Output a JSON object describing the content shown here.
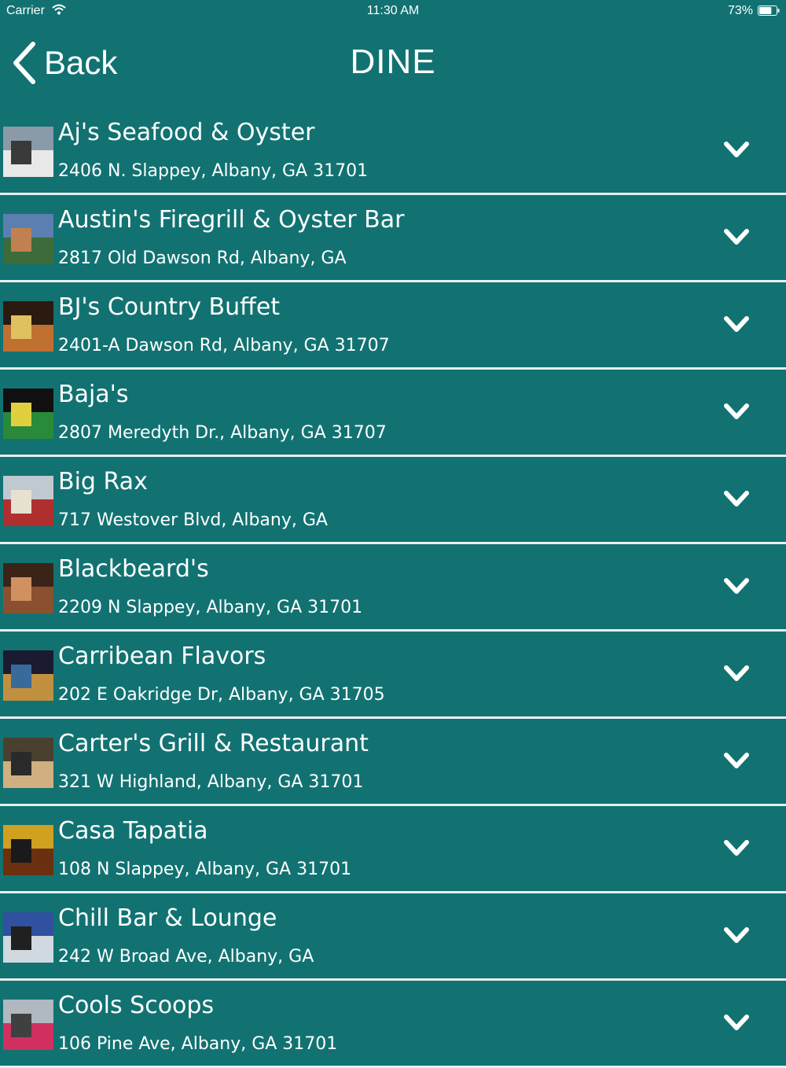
{
  "status_bar": {
    "carrier": "Carrier",
    "time": "11:30 AM",
    "battery": "73%",
    "battery_level": 0.73
  },
  "nav": {
    "back_label": "Back",
    "title": "DINE"
  },
  "restaurants": [
    {
      "name": "Aj's Seafood & Oyster",
      "address": "2406 N. Slappey, Albany, GA 31701"
    },
    {
      "name": "Austin's Firegrill & Oyster Bar",
      "address": "2817 Old Dawson Rd, Albany, GA"
    },
    {
      "name": "BJ's Country Buffet",
      "address": "2401-A Dawson Rd, Albany, GA 31707"
    },
    {
      "name": "Baja's",
      "address": "2807 Meredyth Dr., Albany, GA 31707"
    },
    {
      "name": "Big Rax",
      "address": "717 Westover Blvd, Albany, GA"
    },
    {
      "name": "Blackbeard's",
      "address": "2209 N Slappey, Albany, GA 31701"
    },
    {
      "name": "Carribean Flavors",
      "address": "202 E Oakridge Dr, Albany, GA 31705"
    },
    {
      "name": "Carter's Grill & Restaurant",
      "address": "321 W Highland, Albany, GA 31701"
    },
    {
      "name": "Casa Tapatia",
      "address": "108 N Slappey, Albany, GA 31701"
    },
    {
      "name": "Chill Bar & Lounge",
      "address": "242 W Broad Ave, Albany, GA"
    },
    {
      "name": "Cools Scoops",
      "address": "106 Pine Ave, Albany, GA 31701"
    }
  ],
  "icons": {
    "back": "chevron-left-icon",
    "expand": "chevron-down-icon"
  },
  "colors": {
    "background": "#127272",
    "divider": "#e8f0f0",
    "text": "#ffffff"
  }
}
